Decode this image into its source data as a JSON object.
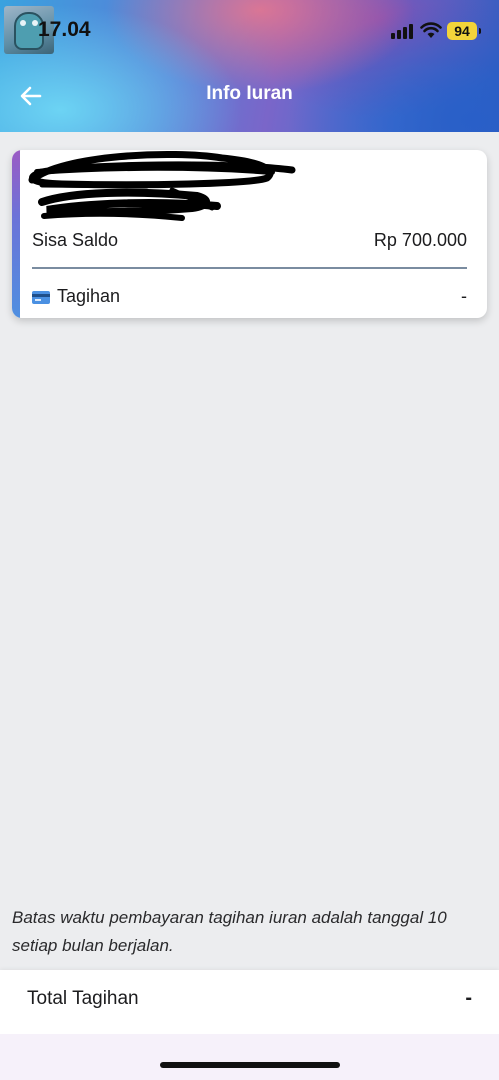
{
  "status_bar": {
    "time": "17.04",
    "battery": "94"
  },
  "header": {
    "title": "Info Iuran",
    "back_icon": "arrow-left-icon",
    "colors": {
      "title": "#ffffff"
    }
  },
  "card": {
    "saldo_label": "Sisa Saldo",
    "saldo_value": "Rp 700.000",
    "tagihan_label": "Tagihan",
    "tagihan_value": "-",
    "tagihan_icon": "credit-card-icon",
    "colors": {
      "accent_top": "#9b5bc4",
      "accent_bottom": "#4f8fe0"
    }
  },
  "notice": {
    "text": "Batas waktu pembayaran tagihan iuran adalah tanggal 10 setiap bulan berjalan."
  },
  "footer": {
    "total_label": "Total Tagihan",
    "total_value": "-"
  }
}
